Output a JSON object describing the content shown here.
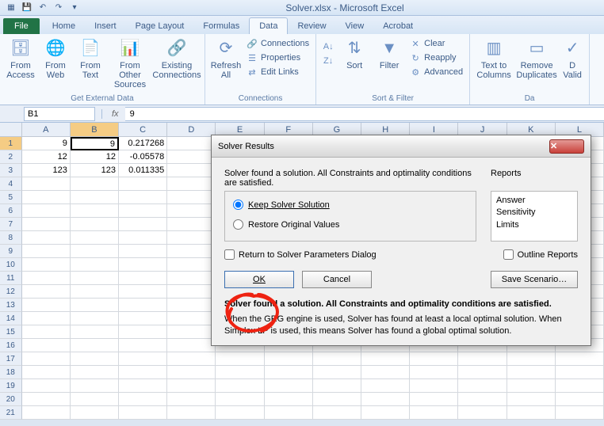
{
  "app": {
    "title": "Solver.xlsx - Microsoft Excel"
  },
  "qat": {
    "save": "save-icon",
    "undo": "undo-icon",
    "redo": "redo-icon"
  },
  "tabs": {
    "file": "File",
    "items": [
      "Home",
      "Insert",
      "Page Layout",
      "Formulas",
      "Data",
      "Review",
      "View",
      "Acrobat"
    ],
    "active": "Data"
  },
  "ribbon": {
    "groups": {
      "get_external": {
        "label": "Get External Data",
        "from_access": "From\nAccess",
        "from_web": "From\nWeb",
        "from_text": "From\nText",
        "from_other": "From Other\nSources",
        "existing": "Existing\nConnections"
      },
      "connections": {
        "label": "Connections",
        "refresh": "Refresh\nAll",
        "connections": "Connections",
        "properties": "Properties",
        "edit_links": "Edit Links"
      },
      "sort_filter": {
        "label": "Sort & Filter",
        "sort": "Sort",
        "filter": "Filter",
        "clear": "Clear",
        "reapply": "Reapply",
        "advanced": "Advanced"
      },
      "data_tools": {
        "label": "Da",
        "text_to_cols": "Text to\nColumns",
        "remove_dup": "Remove\nDuplicates",
        "validation": "D\nValid"
      }
    }
  },
  "namebox": "B1",
  "fx_label": "fx",
  "formula_value": "9",
  "columns": [
    "A",
    "B",
    "C",
    "D",
    "E",
    "F",
    "G",
    "H",
    "I",
    "J",
    "K",
    "L"
  ],
  "selected_col": "B",
  "rows": [
    1,
    2,
    3,
    4,
    5,
    6,
    7,
    8,
    9,
    10,
    11,
    12,
    13,
    14,
    15,
    16,
    17,
    18,
    19,
    20,
    21
  ],
  "selected_row": 1,
  "cells": {
    "r1": {
      "A": "9",
      "B": "9",
      "C": "0.217268"
    },
    "r2": {
      "A": "12",
      "B": "12",
      "C": "-0.05578"
    },
    "r3": {
      "A": "123",
      "B": "123",
      "C": "0.011335"
    }
  },
  "dialog": {
    "title": "Solver Results",
    "message": "Solver found a solution.  All Constraints and optimality conditions are satisfied.",
    "reports_label": "Reports",
    "radio_keep": "Keep Solver Solution",
    "radio_restore": "Restore Original Values",
    "reports": [
      "Answer",
      "Sensitivity",
      "Limits"
    ],
    "chk_return": "Return to Solver Parameters Dialog",
    "chk_outline": "Outline Reports",
    "btn_ok": "OK",
    "btn_cancel": "Cancel",
    "btn_save": "Save Scenario…",
    "bold_msg": "Solver found a solution.  All Constraints and optimality conditions are satisfied.",
    "explain": "When the GRG engine is used, Solver has found at least a local optimal solution. When Simplex LP is used, this means Solver has found a global optimal solution."
  }
}
